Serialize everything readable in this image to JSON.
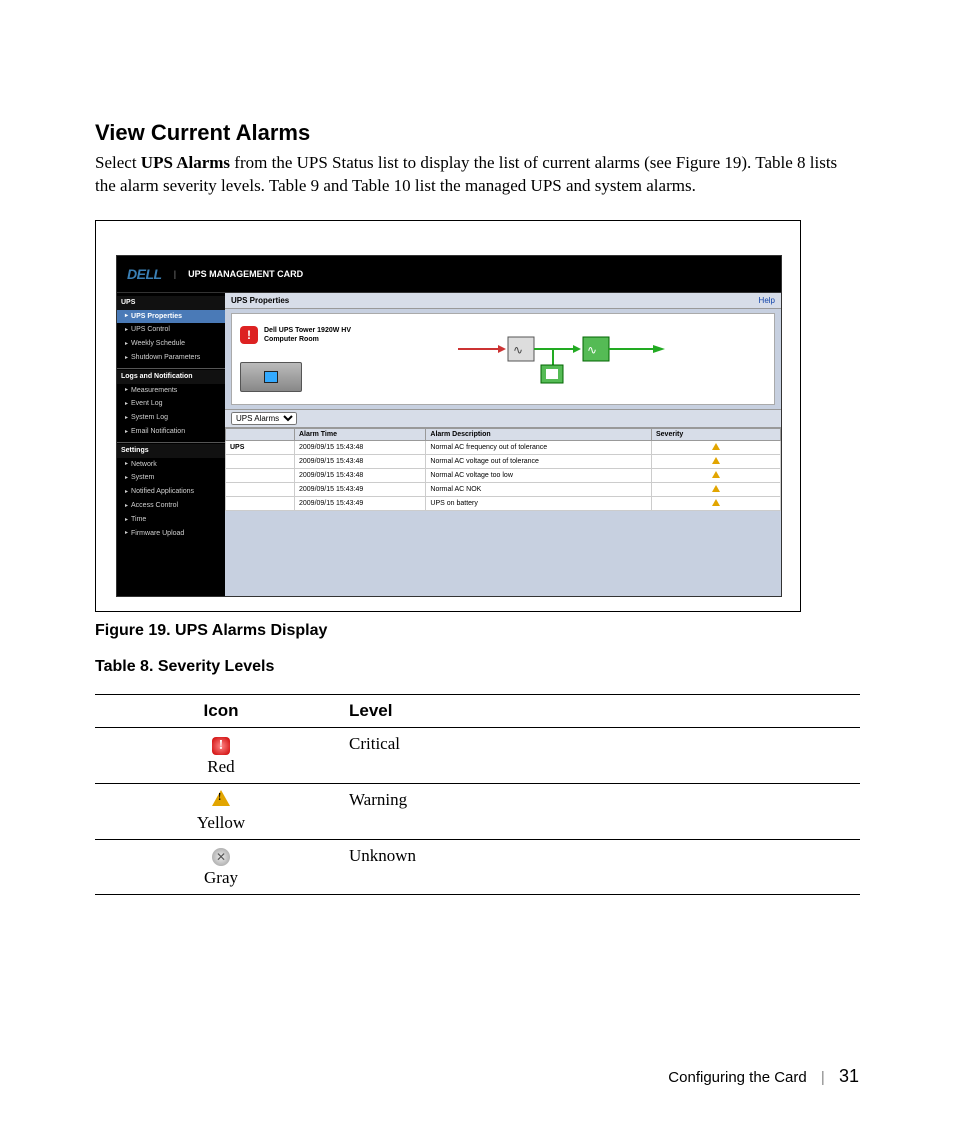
{
  "heading": "View Current Alarms",
  "body_prefix": "Select ",
  "body_bold": "UPS Alarms",
  "body_rest": " from the UPS Status list to display the list of current alarms (see Figure 19). Table 8 lists the alarm severity levels. Table 9 and Table 10 list the managed UPS and system alarms.",
  "figure_caption": "Figure 19. UPS Alarms Display",
  "table_caption": "Table 8. Severity Levels",
  "app": {
    "brand": "DELL",
    "title": "UPS MANAGEMENT CARD",
    "sidebar": {
      "group_ups": "UPS",
      "ups_items": [
        "UPS Properties",
        "UPS Control",
        "Weekly Schedule",
        "Shutdown Parameters"
      ],
      "group_logs": "Logs and Notification",
      "log_items": [
        "Measurements",
        "Event Log",
        "System Log",
        "Email Notification"
      ],
      "group_settings": "Settings",
      "setting_items": [
        "Network",
        "System",
        "Notified Applications",
        "Access Control",
        "Time",
        "Firmware Upload"
      ]
    },
    "panel_title": "UPS Properties",
    "help": "Help",
    "device_name": "Dell UPS Tower 1920W HV",
    "device_location": "Computer Room",
    "dropdown": "UPS Alarms",
    "cols": {
      "time": "Alarm Time",
      "desc": "Alarm Description",
      "sev": "Severity"
    },
    "row_header": "UPS",
    "alarms": [
      {
        "time": "2009/09/15 15:43:48",
        "desc": "Normal AC frequency out of tolerance"
      },
      {
        "time": "2009/09/15 15:43:48",
        "desc": "Normal AC voltage out of tolerance"
      },
      {
        "time": "2009/09/15 15:43:48",
        "desc": "Normal AC voltage too low"
      },
      {
        "time": "2009/09/15 15:43:49",
        "desc": "Normal AC NOK"
      },
      {
        "time": "2009/09/15 15:43:49",
        "desc": "UPS on battery"
      }
    ]
  },
  "sev_cols": {
    "icon": "Icon",
    "level": "Level"
  },
  "sev_rows": [
    {
      "color": "Red",
      "level": "Critical"
    },
    {
      "color": "Yellow",
      "level": "Warning"
    },
    {
      "color": "Gray",
      "level": "Unknown"
    }
  ],
  "footer_section": "Configuring the Card",
  "footer_page": "31"
}
